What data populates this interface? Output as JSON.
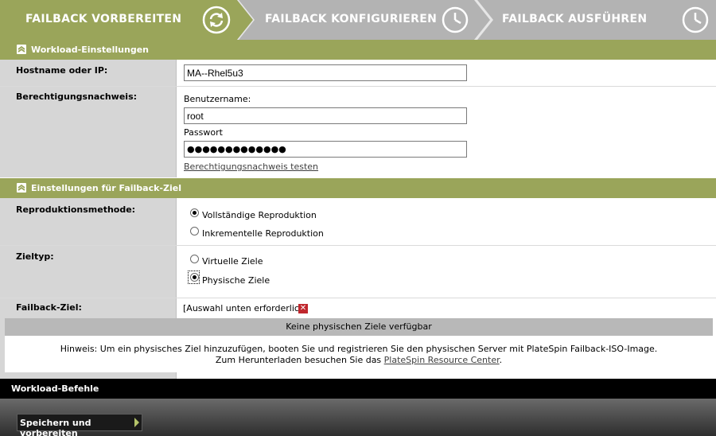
{
  "steps": [
    {
      "label": "FAILBACK VORBEREITEN",
      "icon": "refresh-icon",
      "active": true
    },
    {
      "label": "FAILBACK KONFIGURIEREN",
      "icon": "clock-icon",
      "active": false
    },
    {
      "label": "FAILBACK AUSFÜHREN",
      "icon": "clock-icon",
      "active": false
    }
  ],
  "colors": {
    "active_step": "#9aa55a",
    "inactive_step": "#b3b3b3",
    "section_header": "#9aa55a",
    "error": "#c0272d"
  },
  "workload": {
    "section_title": "Workload-Einstellungen",
    "hostname_label": "Hostname oder IP:",
    "hostname_value": "MA--Rhel5u3",
    "credentials_label": "Berechtigungsnachweis:",
    "username_label": "Benutzername:",
    "username_value": "root",
    "password_label": "Passwort",
    "password_value": "●●●●●●●●●●●●●",
    "test_link": "Berechtigungsnachweis testen"
  },
  "target": {
    "section_title": "Einstellungen für Failback-Ziel",
    "method_label": "Reproduktionsmethode:",
    "method_options": [
      {
        "label": "Vollständige Reproduktion",
        "selected": true
      },
      {
        "label": "Inkrementelle Reproduktion",
        "selected": false
      }
    ],
    "type_label": "Zieltyp:",
    "type_options": [
      {
        "label": "Virtuelle Ziele",
        "selected": false
      },
      {
        "label": "Physische Ziele",
        "selected": true
      }
    ],
    "failback_label": "Failback-Ziel:",
    "failback_value": "[Auswahl unten erforderlich]",
    "no_targets": "Keine physischen Ziele verfügbar",
    "hint_line1": "Hinweis: Um ein physisches Ziel hinzuzufügen, booten Sie und registrieren Sie den physischen Server mit PlateSpin Failback-ISO-Image.",
    "hint_line2_prefix": "Zum Herunterladen besuchen Sie das ",
    "hint_link": "PlateSpin Resource Center",
    "hint_line2_suffix": "."
  },
  "commands": {
    "title": "Workload-Befehle",
    "save_button": "Speichern und vorbereiten"
  }
}
